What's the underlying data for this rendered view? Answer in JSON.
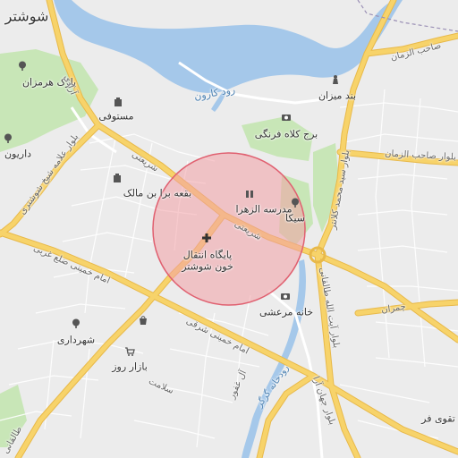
{
  "map": {
    "colors": {
      "water": "#a5c8ea",
      "park": "#c8e6b7",
      "major_road": "#f7d36a",
      "minor_road": "#ffffff",
      "land": "#ececec",
      "circle_fill": "#f2a0a5",
      "circle_stroke": "#e06070"
    },
    "labels": {
      "city": "شوشتر",
      "river": "رود کارون",
      "park_hormozan": "پارک هرمزان",
      "daryoon": "داریون",
      "mostofi": "مستوفی",
      "band_mizan": "بند میزان",
      "burj_kolah_farangi": "برج کلاه فرنگی",
      "buqe_bera_bin_malek": "بقعه برا بن مالک",
      "madrese_zahra": "مدرسه الزهرا",
      "sika": "سیکا",
      "blood_center_l1": "پایگاه انتقال",
      "blood_center_l2": "خون شوشتر",
      "khane_marashi": "خانه مرعشی",
      "shahrdari": "شهرداری",
      "bazar_rooz": "بازار روز",
      "taghva_far": "تقوی فر",
      "rudkhane_gargar": "رودخانه گرگر",
      "shariati_1": "شریعتی",
      "shariati_2": "شریعتی",
      "allameh": "بلوار علامه شیخ شوشتری",
      "azadi": "آزادی",
      "sahab_zaman_1": "صاحب الزمان",
      "sahab_zaman_2": "بلوار صاحب الزمان",
      "sayed_mohammad": "بلوار سید محمد کلانتر",
      "ayatollah_taleghani": "بلوار آیت الله طالقانی",
      "chamran": "چمران",
      "khomeini_gharbi": "امام خمینی ضلع غربی",
      "khomeini_sharghi": "امام خمینی شرقی",
      "salamat": "سلامت",
      "al_ghafoor": "آل غفور",
      "jahan_ara": "بلوار جهان آرا",
      "taleghani_partial": "طالقانی"
    },
    "icons": {
      "park": "tree-icon",
      "museum": "camera-icon",
      "school": "building-icon",
      "hospital": "cross-icon",
      "shop": "bag-icon",
      "cart": "cart-icon",
      "monument": "monument-icon"
    }
  }
}
